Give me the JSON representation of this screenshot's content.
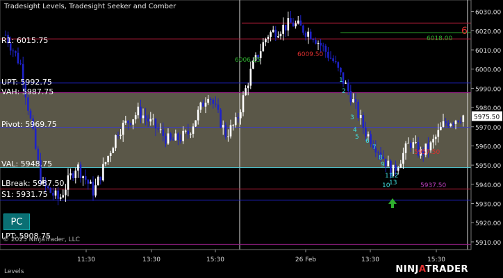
{
  "title": "Tradesight Levels, Tradesight Seeker and Comber",
  "copyright": "© 2025 NinjaTrader, LLC",
  "footer_tab": "Levels",
  "pc_button": "PC",
  "brand": {
    "pre": "NINJ",
    "mid": "A",
    "post": "TRADER"
  },
  "colors": {
    "bg": "#000000",
    "value_area": "#5a5748",
    "up": "#ffffff",
    "down": "#1e22c8",
    "pivot": "#3b3bc8",
    "resistance": "#b01c38",
    "support": "#b01c38",
    "vah": "#9a1f8a",
    "lpt": "#9a1f8a",
    "upt": "#1e22c8",
    "val": "#57d3e0",
    "s1": "#1e22c8"
  },
  "price_axis": {
    "ticks": [
      "6030.00",
      "6020.00",
      "6010.00",
      "6000.00",
      "5990.00",
      "5980.00",
      "5970.00",
      "5960.00",
      "5950.00",
      "5940.00",
      "5930.00",
      "5920.00",
      "5910.00"
    ],
    "current": "5975.50",
    "range": [
      5908,
      6034
    ]
  },
  "time_axis": {
    "ticks": [
      "11:30",
      "13:30",
      "15:30",
      "26 Feb",
      "13:30",
      "15:30"
    ]
  },
  "levels": [
    {
      "label": "R1: 6015.75",
      "price": 6015.75,
      "color": "#b01c38"
    },
    {
      "label": "UPT: 5992.75",
      "price": 5992.75,
      "color": "#1e22c8"
    },
    {
      "label": "VAH: 5987.75",
      "price": 5987.75,
      "color": "#9a1f8a"
    },
    {
      "label": "Pivot: 5969.75",
      "price": 5969.75,
      "color": "#3b3bc8"
    },
    {
      "label": "VAL: 5948.75",
      "price": 5948.75,
      "color": "#57d3e0"
    },
    {
      "label": "LBreak: 5937.50",
      "price": 5937.5,
      "color": "#b01c38"
    },
    {
      "label": "S1: 5931.75",
      "price": 5931.75,
      "color": "#1e22c8"
    },
    {
      "label": "LPT: 5908.75",
      "price": 5908.75,
      "color": "#9a1f8a"
    }
  ],
  "annotations": [
    {
      "text": "6",
      "color": "#e03030",
      "price": 6024
    },
    {
      "text": "6018.00",
      "color": "#2fae2f",
      "price": 6019
    },
    {
      "text": "6006.25",
      "color": "#2fae2f",
      "price": 6008
    },
    {
      "text": "6009.50",
      "color": "#e03030",
      "price": 6011
    },
    {
      "text": "5957.50",
      "color": "#e03030",
      "price": 5958
    },
    {
      "text": "5937.50",
      "color": "#c040c0",
      "price": 5939
    },
    {
      "text": "1",
      "color": "#40e0e0"
    },
    {
      "text": "2",
      "color": "#40e0e0"
    },
    {
      "text": "3",
      "color": "#40e0e0"
    },
    {
      "text": "4",
      "color": "#40e0e0"
    },
    {
      "text": "5",
      "color": "#40e0e0"
    },
    {
      "text": "6",
      "color": "#40e0e0"
    },
    {
      "text": "7",
      "color": "#40e0e0"
    },
    {
      "text": "8",
      "color": "#40e0e0"
    },
    {
      "text": "9",
      "color": "#40e0e0"
    },
    {
      "text": "10",
      "color": "#40e0e0"
    },
    {
      "text": "11",
      "color": "#40e0e0"
    },
    {
      "text": "12",
      "color": "#40e0e0"
    },
    {
      "text": "13",
      "color": "#40e0e0"
    }
  ]
}
